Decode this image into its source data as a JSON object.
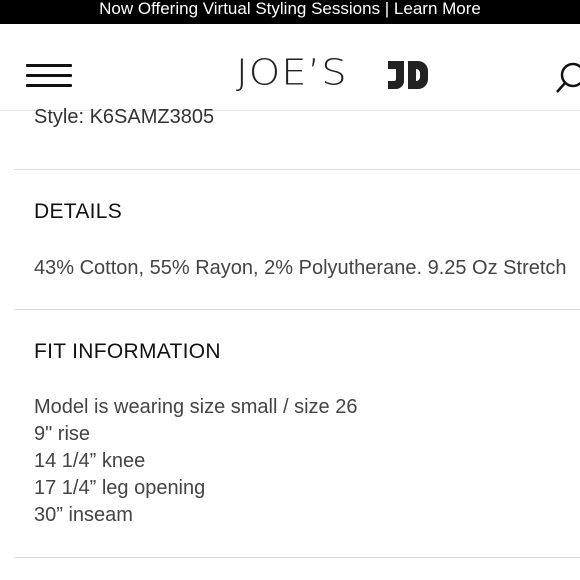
{
  "promo": {
    "text": "Now Offering Virtual Styling Sessions | Learn More"
  },
  "header": {
    "menu_icon": "hamburger-menu-icon",
    "logo_text": "JOE’S",
    "logo_mark": "JD",
    "search_icon": "search-icon"
  },
  "product": {
    "style_label": "Style: K6SAMZ3805",
    "details": {
      "title": "DETAILS",
      "text": "43% Cotton, 55% Rayon, 2% Polyutherane. 9.25 Oz Stretch"
    },
    "fit": {
      "title": "FIT INFORMATION",
      "lines": [
        "Model is wearing size small / size 26",
        "9\" rise",
        "14 1/4” knee",
        "17 1/4” leg opening",
        "30” inseam"
      ]
    }
  }
}
